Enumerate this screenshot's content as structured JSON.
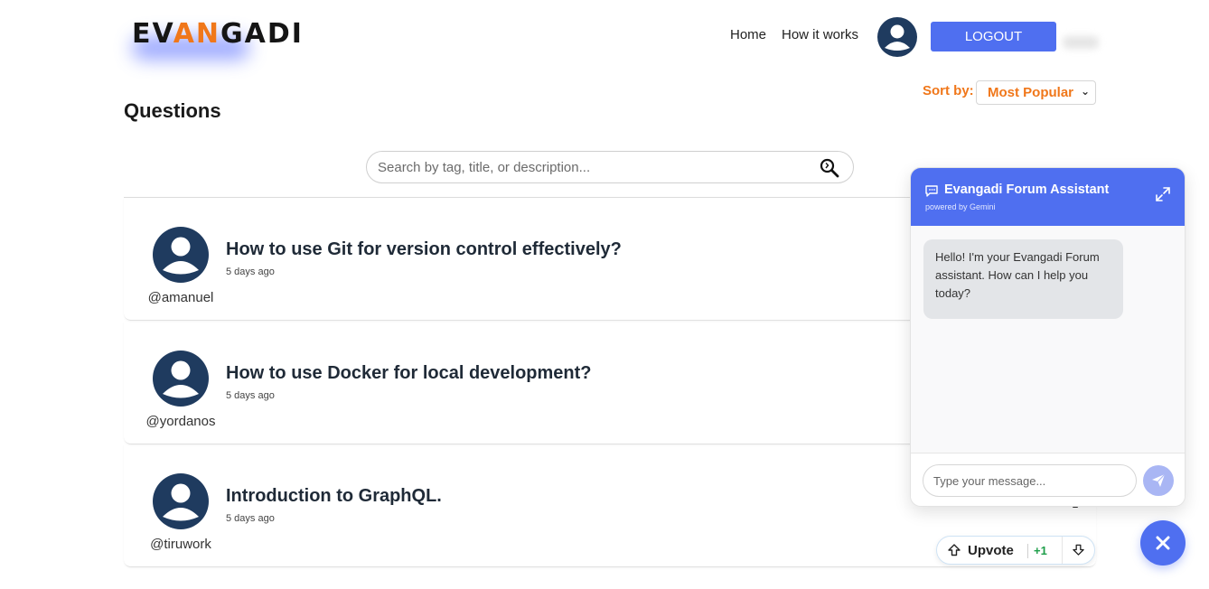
{
  "header": {
    "logo_prefix": "EV",
    "logo_accent": "AN",
    "logo_suffix": "GADI",
    "nav": {
      "home": "Home",
      "how_it_works": "How it works"
    },
    "logout_label": "LOGOUT"
  },
  "sort": {
    "label": "Sort by:",
    "selected": "Most Popular"
  },
  "page_title": "Questions",
  "search": {
    "placeholder": "Search by tag, title, or description..."
  },
  "questions": [
    {
      "title": "How to use Git for version control effectively?",
      "time": "5 days ago",
      "user": "@amanuel"
    },
    {
      "title": "How to use Docker for local development?",
      "time": "5 days ago",
      "user": "@yordanos"
    },
    {
      "title": "Introduction to GraphQL.",
      "time": "5 days ago",
      "user": "@tiruwork"
    }
  ],
  "vote": {
    "label": "Upvote",
    "count": "+1"
  },
  "chat": {
    "title": "Evangadi Forum Assistant",
    "subtitle": "powered by Gemini",
    "greeting": "Hello! I'm your Evangadi Forum assistant. How can I help you today?",
    "input_placeholder": "Type your message..."
  },
  "colors": {
    "accent": "#f0771a",
    "primary": "#4f6ff0",
    "avatar": "#1f3b5f",
    "vote_count": "#1e9e4a"
  },
  "icons": [
    "user-avatar-icon",
    "search-icon",
    "upvote-arrow-icon",
    "downvote-arrow-icon",
    "chat-bubble-icon",
    "expand-icon",
    "send-icon",
    "close-icon"
  ]
}
